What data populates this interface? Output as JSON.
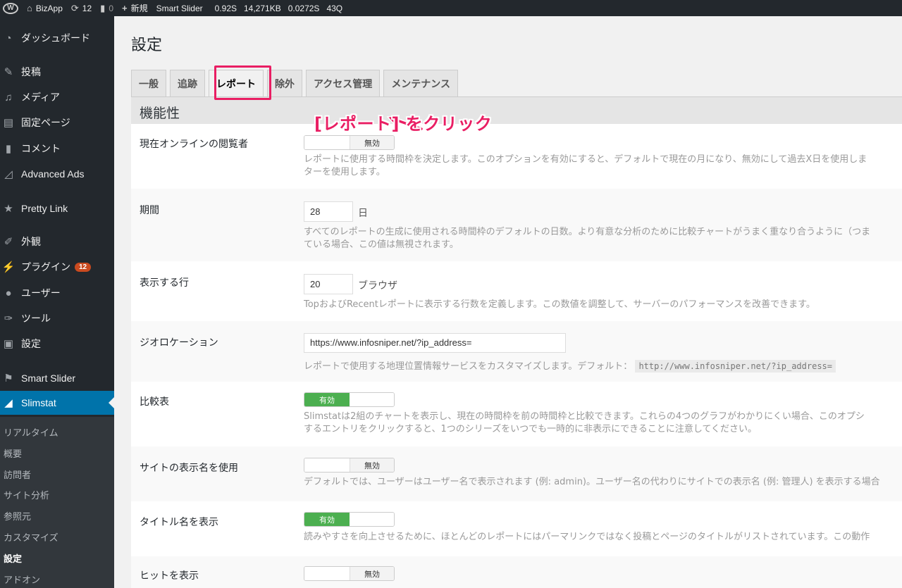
{
  "admin_bar": {
    "site_name": "BizApp",
    "updates_count": "12",
    "comments_count": "0",
    "new_label": "新規",
    "plugin_label": "Smart Slider",
    "stat_time": "0.92s",
    "stat_memory": "14,271kB",
    "stat_query_time": "0.0272s",
    "stat_queries": "43q"
  },
  "sidebar": {
    "items": [
      {
        "label": "ダッシュボード",
        "icon": "dashboard-icon"
      },
      {
        "label": "投稿",
        "icon": "pin-icon"
      },
      {
        "label": "メディア",
        "icon": "media-icon"
      },
      {
        "label": "固定ページ",
        "icon": "page-icon"
      },
      {
        "label": "コメント",
        "icon": "comment-icon"
      },
      {
        "label": "Advanced Ads",
        "icon": "chart-icon"
      },
      {
        "label": "Pretty Link",
        "icon": "link-star-icon"
      },
      {
        "label": "外観",
        "icon": "brush-icon"
      },
      {
        "label": "プラグイン",
        "icon": "plugin-icon",
        "badge": "12"
      },
      {
        "label": "ユーザー",
        "icon": "user-icon"
      },
      {
        "label": "ツール",
        "icon": "wrench-icon"
      },
      {
        "label": "設定",
        "icon": "settings-icon"
      },
      {
        "label": "Smart Slider",
        "icon": "slider-icon"
      },
      {
        "label": "Slimstat",
        "icon": "slimstat-icon",
        "current": true
      }
    ],
    "submenu": [
      "リアルタイム",
      "概要",
      "訪問者",
      "サイト分析",
      "参照元",
      "カスタマイズ",
      "設定",
      "アドオン"
    ],
    "submenu_active": "設定"
  },
  "page": {
    "title": "設定",
    "tabs": [
      "一般",
      "追跡",
      "レポート",
      "除外",
      "アクセス管理",
      "メンテナンス"
    ],
    "active_tab": "レポート",
    "section_title": "機能性",
    "annotation": "[レポート] をクリック"
  },
  "settings": {
    "online_visitors": {
      "label": "現在オンラインの閲覧者",
      "toggle": "無効",
      "desc_line1": "レポートに使用する時間枠を決定します。このオプションを有効にすると、デフォルトで現在の月になり、無効にして過去X日を使用しま",
      "desc_line2": "ターを使用します。"
    },
    "period": {
      "label": "期間",
      "value": "28",
      "unit": "日",
      "desc_line1": "すべてのレポートの生成に使用される時間枠のデフォルトの日数。より有意な分析のために比較チャートがうまく重なり合うように（つま",
      "desc_line2": "ている場合、この値は無視されます。"
    },
    "rows_to_display": {
      "label": "表示する行",
      "value": "20",
      "unit": "ブラウザ",
      "desc": "TopおよびRecentレポートに表示する行数を定義します。この数値を調整して、サーバーのパフォーマンスを改善できます。"
    },
    "geolocation": {
      "label": "ジオロケーション",
      "value": "https://www.infosniper.net/?ip_address=",
      "desc": "レポートで使用する地理位置情報サービスをカスタマイズします。デフォルト：",
      "default_code": "http://www.infosniper.net/?ip_address="
    },
    "comparison": {
      "label": "比較表",
      "toggle": "有効",
      "desc_line1": "Slimstatは2組のチャートを表示し、現在の時間枠を前の時間枠と比較できます。これらの4つのグラフがわかりにくい場合、このオプシ",
      "desc_line2": "するエントリをクリックすると、1つのシリーズをいつでも一時的に非表示にできることに注意してください。"
    },
    "site_display_name": {
      "label": "サイトの表示名を使用",
      "toggle": "無効",
      "desc": "デフォルトでは、ユーザーはユーザー名で表示されます (例: admin)。ユーザー名の代わりにサイトでの表示名 (例: 管理人) を表示する場合"
    },
    "show_title": {
      "label": "タイトル名を表示",
      "toggle": "有効",
      "desc": "読みやすさを向上させるために、ほとんどのレポートにはパーマリンクではなく投稿とページのタイトルがリストされています。この動作"
    },
    "show_hits": {
      "label": "ヒットを表示",
      "toggle": "無効"
    }
  },
  "colors": {
    "accent": "#0073aa",
    "highlight": "#e91e63",
    "toggle_on": "#4caf50"
  }
}
